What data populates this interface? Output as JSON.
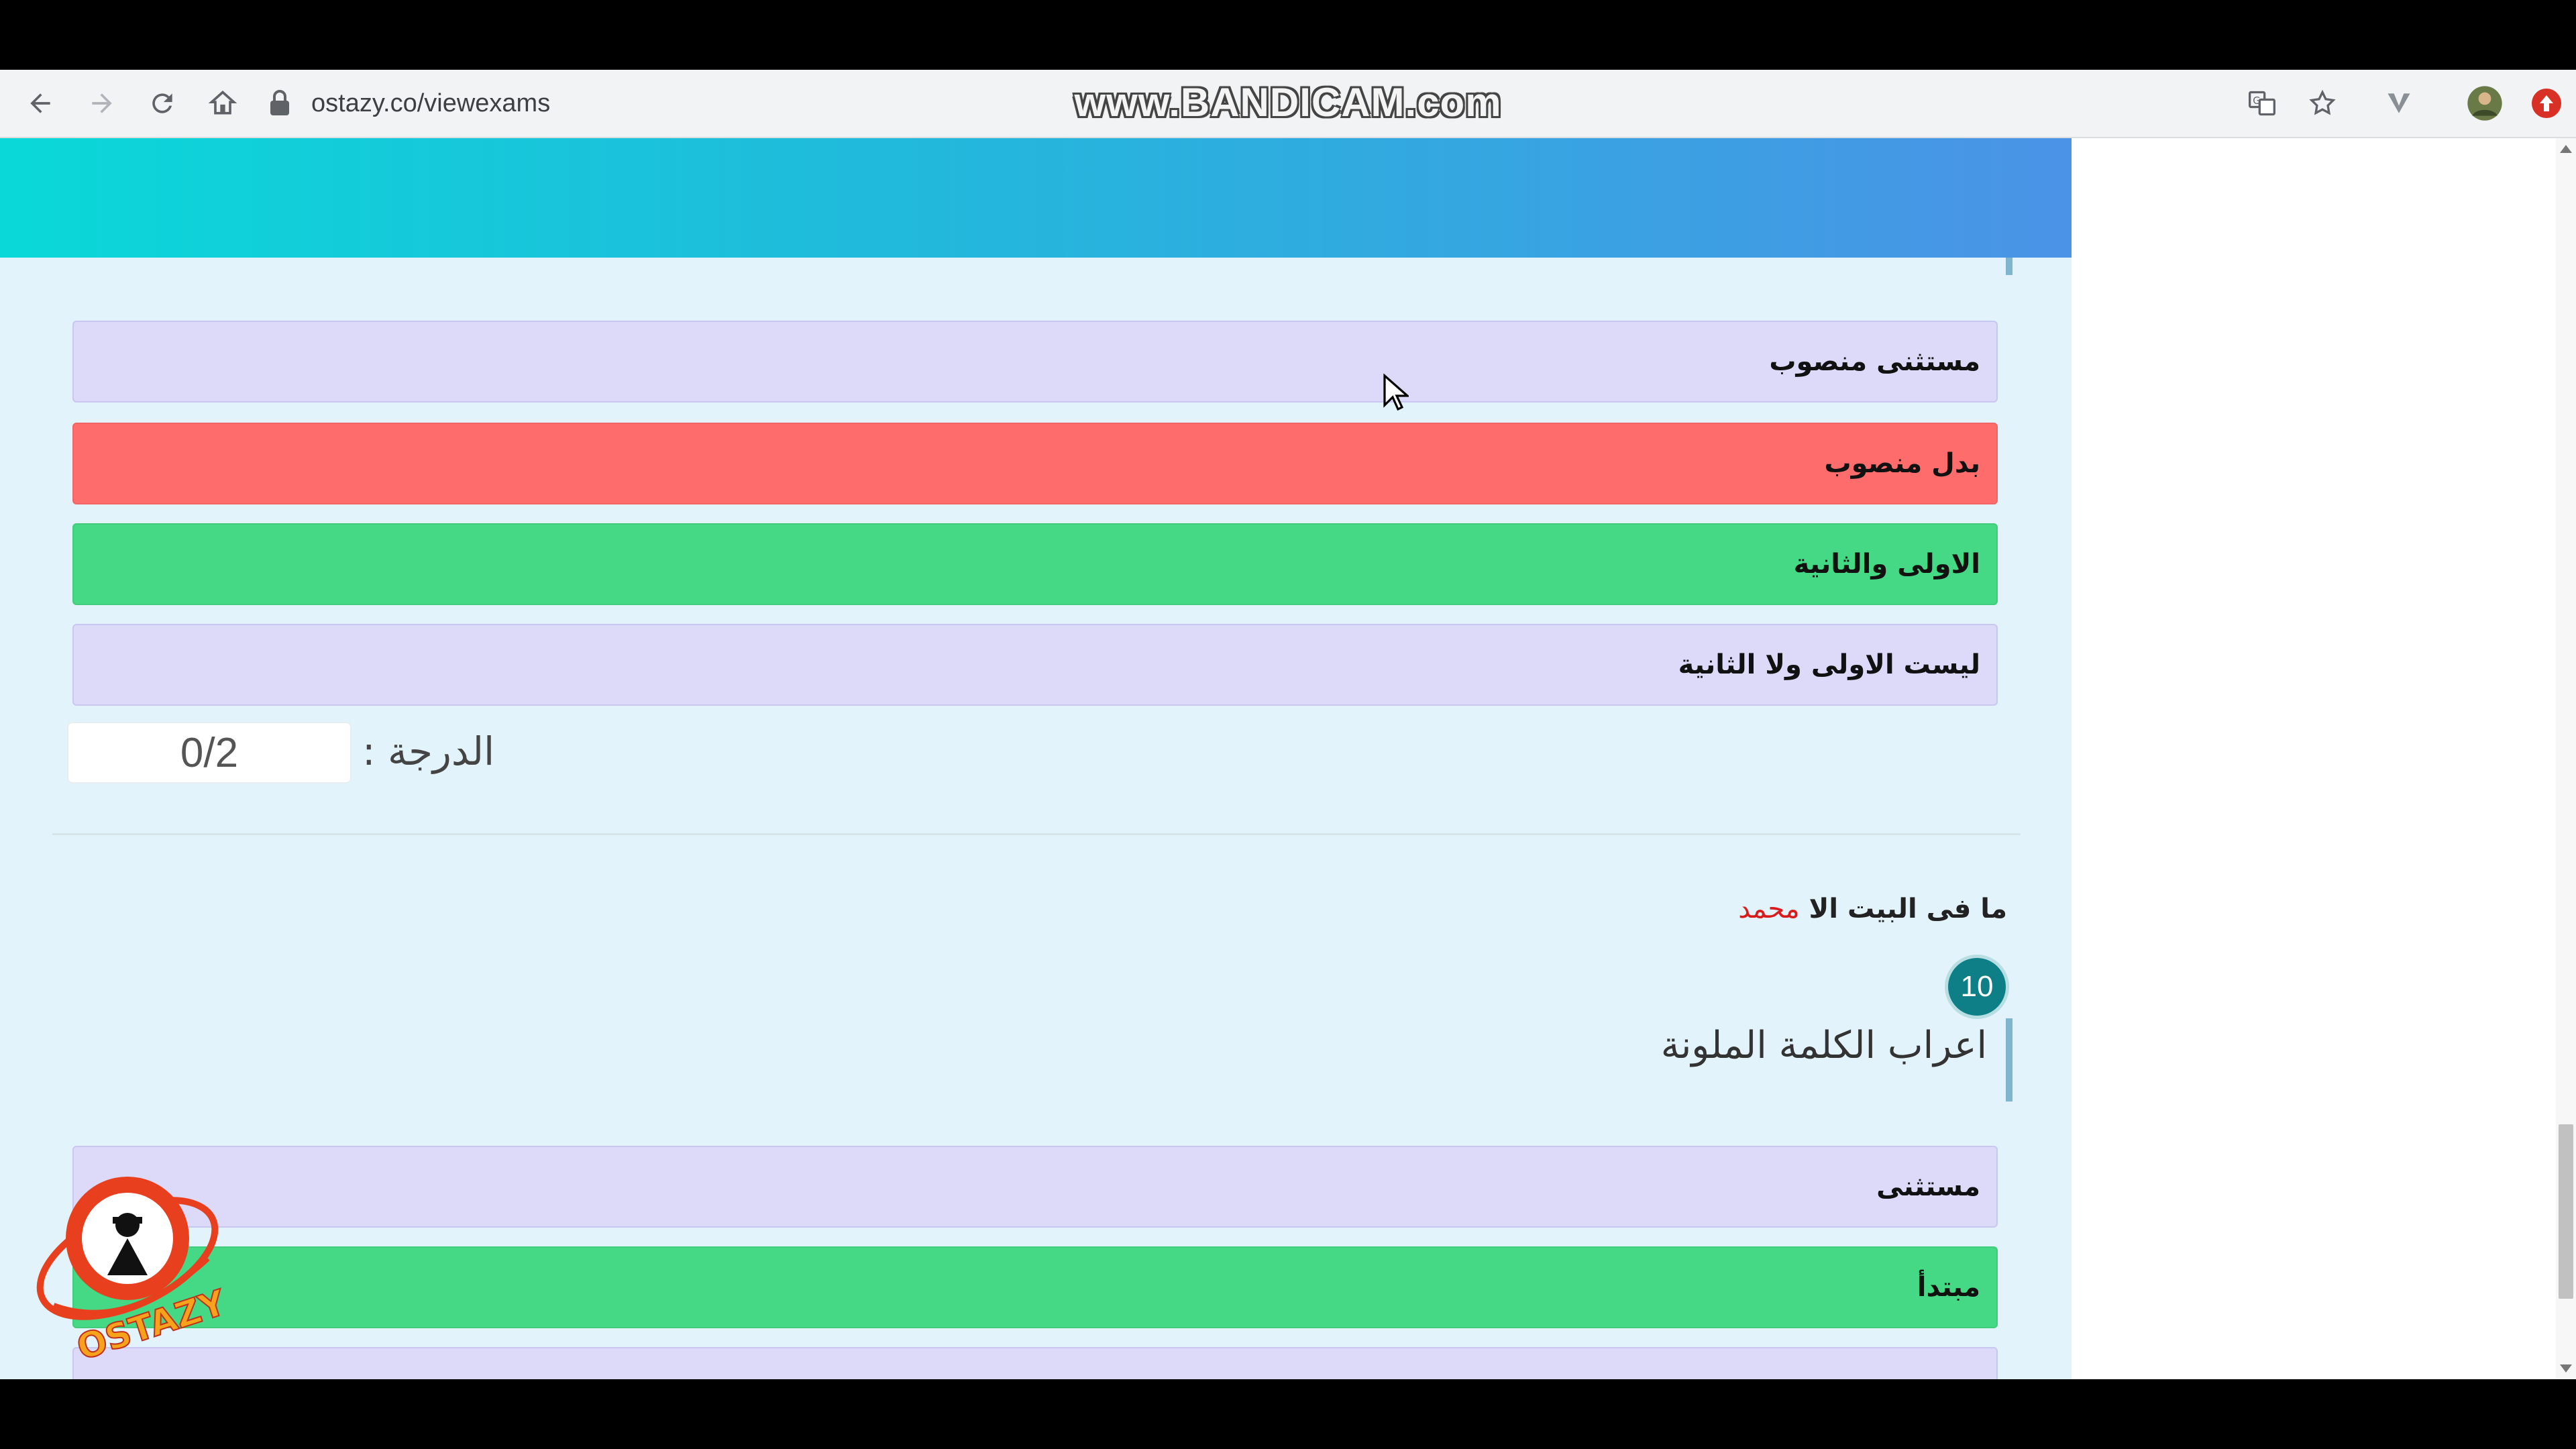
{
  "browser": {
    "url": "ostazy.co/viewexams",
    "watermark": "www.BANDICAM.com"
  },
  "question9": {
    "options": [
      {
        "label": "مستثنى منصوب",
        "state": "neutral"
      },
      {
        "label": "بدل منصوب",
        "state": "wrong"
      },
      {
        "label": "الاولى والثانية",
        "state": "correct"
      },
      {
        "label": "ليست الاولى ولا الثانية",
        "state": "neutral"
      }
    ],
    "score_label": "الدرجة :",
    "score_value": "0/2"
  },
  "question10": {
    "sentence_prefix": "ما فى البيت الا",
    "sentence_highlight": "محمد",
    "number": "10",
    "title": "اعراب الكلمة الملونة",
    "options": [
      {
        "label": "مستثنى",
        "state": "neutral"
      },
      {
        "label": "مبتدأ",
        "state": "correct"
      }
    ]
  },
  "logo_text": "OSTAZY",
  "colors": {
    "wrong": "#fe6c6c",
    "correct": "#46d985",
    "neutral": "#dcdaf8",
    "highlight": "#d81b1b",
    "badge": "#0e7f86"
  }
}
